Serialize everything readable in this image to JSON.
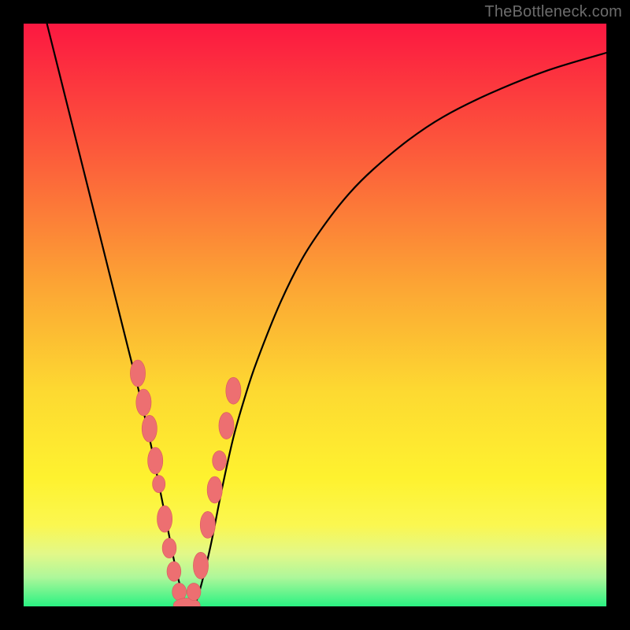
{
  "watermark": "TheBottleneck.com",
  "colors": {
    "frame": "#000000",
    "grad_top": "#fc1841",
    "grad_mid1": "#fb7f37",
    "grad_mid2": "#fcd731",
    "grad_mid3": "#fdf42f",
    "grad_mid4": "#e6f86f",
    "grad_bottom": "#2af282",
    "curve": "#000000",
    "marker_fill": "#ed6f71",
    "marker_stroke": "#d85a5c"
  },
  "chart_data": {
    "type": "line",
    "title": "",
    "xlabel": "",
    "ylabel": "",
    "xlim": [
      0,
      100
    ],
    "ylim": [
      0,
      100
    ],
    "series": [
      {
        "name": "bottleneck-curve",
        "x": [
          4,
          6,
          8,
          10,
          12,
          14,
          16,
          18,
          20,
          22,
          23,
          24,
          25,
          26,
          27,
          28,
          29,
          30,
          32,
          34,
          36,
          38,
          40,
          44,
          48,
          52,
          56,
          60,
          66,
          72,
          80,
          90,
          100
        ],
        "y": [
          100,
          92,
          84,
          76,
          68,
          60,
          52,
          44,
          36,
          27,
          22,
          17,
          12,
          7,
          3,
          0,
          0,
          2,
          10,
          20,
          29,
          36,
          42,
          52,
          60,
          66,
          71,
          75,
          80,
          84,
          88,
          92,
          95
        ]
      }
    ],
    "markers": [
      {
        "x": 19.6,
        "y": 40,
        "rx": 1.3,
        "ry": 2.3
      },
      {
        "x": 20.6,
        "y": 35,
        "rx": 1.3,
        "ry": 2.3
      },
      {
        "x": 21.6,
        "y": 30.5,
        "rx": 1.3,
        "ry": 2.3
      },
      {
        "x": 22.6,
        "y": 25,
        "rx": 1.3,
        "ry": 2.3
      },
      {
        "x": 23.2,
        "y": 21,
        "rx": 1.1,
        "ry": 1.5
      },
      {
        "x": 24.2,
        "y": 15,
        "rx": 1.3,
        "ry": 2.3
      },
      {
        "x": 25.0,
        "y": 10,
        "rx": 1.2,
        "ry": 1.7
      },
      {
        "x": 25.8,
        "y": 6,
        "rx": 1.2,
        "ry": 1.7
      },
      {
        "x": 26.7,
        "y": 2.5,
        "rx": 1.2,
        "ry": 1.5
      },
      {
        "x": 28.0,
        "y": 0.2,
        "rx": 2.3,
        "ry": 1.2
      },
      {
        "x": 29.2,
        "y": 2.5,
        "rx": 1.2,
        "ry": 1.5
      },
      {
        "x": 30.4,
        "y": 7,
        "rx": 1.3,
        "ry": 2.3
      },
      {
        "x": 31.6,
        "y": 14,
        "rx": 1.3,
        "ry": 2.3
      },
      {
        "x": 32.8,
        "y": 20,
        "rx": 1.3,
        "ry": 2.3
      },
      {
        "x": 33.6,
        "y": 25,
        "rx": 1.2,
        "ry": 1.7
      },
      {
        "x": 34.8,
        "y": 31,
        "rx": 1.3,
        "ry": 2.3
      },
      {
        "x": 36.0,
        "y": 37,
        "rx": 1.3,
        "ry": 2.3
      }
    ],
    "notch": {
      "x": 28,
      "depth": 0
    }
  }
}
